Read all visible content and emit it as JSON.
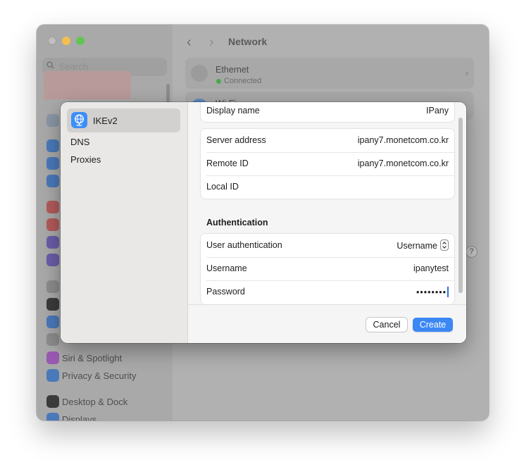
{
  "window": {
    "title": "Network",
    "search_placeholder": "Search",
    "sidebar_items": [
      {
        "label": "Siri & Spotlight",
        "icon": "siri-icon",
        "color": "#b54fd6"
      },
      {
        "label": "Privacy & Security",
        "icon": "hand-icon",
        "color": "#3a83f1"
      },
      {
        "label": "Desktop & Dock",
        "icon": "dock-icon",
        "color": "#3b3b3b"
      },
      {
        "label": "Displays",
        "icon": "display-icon",
        "color": "#3a83f1"
      }
    ],
    "services": [
      {
        "name": "Ethernet",
        "status": "Connected"
      },
      {
        "name": "Wi-Fi"
      }
    ],
    "help_label": "?"
  },
  "dialog": {
    "sidebar": {
      "items": [
        {
          "label": "IKEv2",
          "selected": true,
          "icon": "vpn-globe-icon"
        },
        {
          "label": "DNS"
        },
        {
          "label": "Proxies"
        }
      ]
    },
    "display_name": {
      "label": "Display name",
      "value": "IPany"
    },
    "server_address": {
      "label": "Server address",
      "value": "ipany7.monetcom.co.kr"
    },
    "remote_id": {
      "label": "Remote ID",
      "value": "ipany7.monetcom.co.kr"
    },
    "local_id": {
      "label": "Local ID",
      "value": ""
    },
    "authentication": {
      "heading": "Authentication",
      "user_auth": {
        "label": "User authentication",
        "value": "Username"
      },
      "username": {
        "label": "Username",
        "value": "ipanytest"
      },
      "password": {
        "label": "Password",
        "value": "••••••••"
      }
    },
    "buttons": {
      "cancel": "Cancel",
      "create": "Create"
    },
    "accent_color": "#3b87f3"
  }
}
